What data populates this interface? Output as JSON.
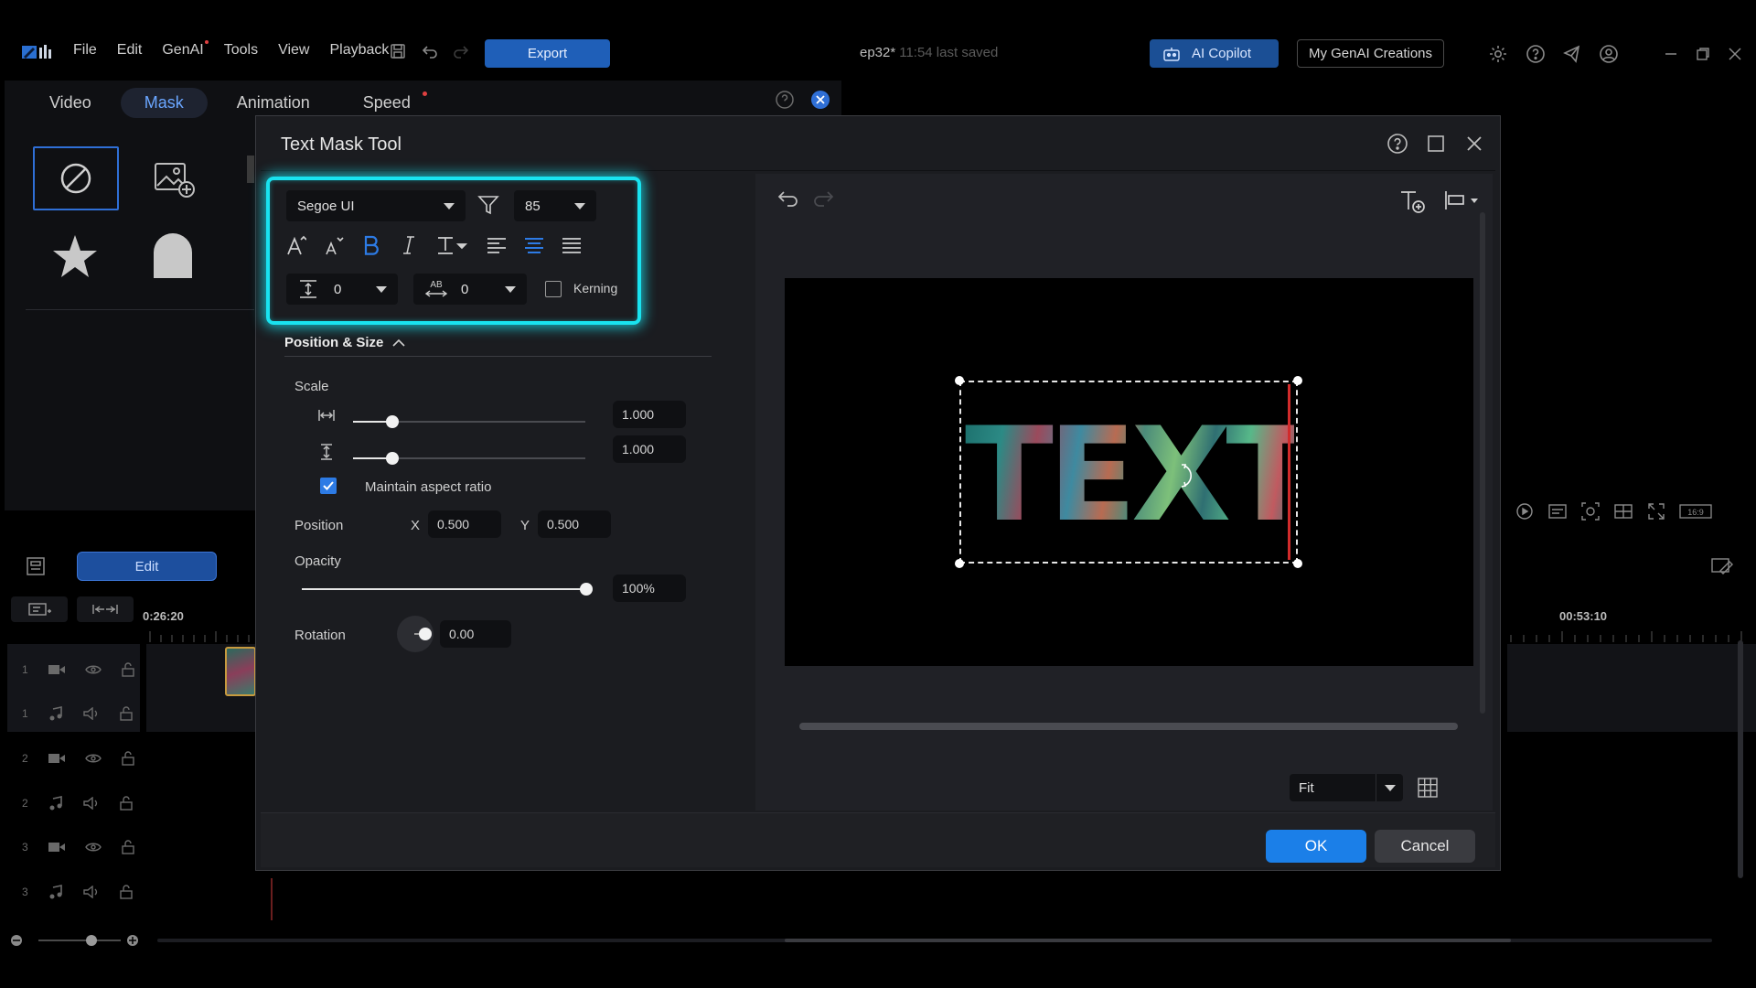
{
  "menu": [
    "File",
    "Edit",
    "GenAI",
    "Tools",
    "View",
    "Playback"
  ],
  "toolbar": {
    "export_label": "Export",
    "copilot_label": "AI Copilot",
    "genai_creations_label": "My GenAI Creations"
  },
  "project": {
    "name": "ep32*",
    "saved_status": "11:54 last saved"
  },
  "panel_tabs": [
    {
      "label": "Video"
    },
    {
      "label": "Mask",
      "active": true
    },
    {
      "label": "Animation"
    },
    {
      "label": "Speed"
    }
  ],
  "left_panel": {
    "edit_label": "Edit"
  },
  "timeline": {
    "time_left": "0:26:20",
    "time_right": "00:53:10",
    "tracks": [
      {
        "num": "1",
        "type": "video"
      },
      {
        "num": "1",
        "type": "audio"
      },
      {
        "num": "2",
        "type": "video"
      },
      {
        "num": "2",
        "type": "audio"
      },
      {
        "num": "3",
        "type": "video"
      },
      {
        "num": "3",
        "type": "audio"
      }
    ]
  },
  "dialog": {
    "title": "Text Mask Tool",
    "font": {
      "family": "Segoe UI",
      "size": "85",
      "line_spacing": "0",
      "char_spacing": "0",
      "kerning_label": "Kerning",
      "kerning_checked": false,
      "bold_active": true,
      "align_active": "center"
    },
    "position_size": {
      "section_label": "Position & Size",
      "scale_label": "Scale",
      "scale_width": "1.000",
      "scale_height": "1.000",
      "scale_width_level": 0.17,
      "scale_height_level": 0.17,
      "maintain_aspect_label": "Maintain aspect ratio",
      "maintain_aspect_checked": true,
      "position_label": "Position",
      "x_label": "X",
      "x_value": "0.500",
      "y_label": "Y",
      "y_value": "0.500",
      "opacity_label": "Opacity",
      "opacity_value": "100%",
      "opacity_level": 1.0,
      "rotation_label": "Rotation",
      "rotation_value": "0.00"
    },
    "preview": {
      "text": "TEXT",
      "zoom": "Fit"
    },
    "ok_label": "OK",
    "cancel_label": "Cancel"
  },
  "colors": {
    "accent": "#2d7be5",
    "highlight": "#19e3f0",
    "export": "#1f5fb8",
    "ok": "#1b7fe8"
  }
}
